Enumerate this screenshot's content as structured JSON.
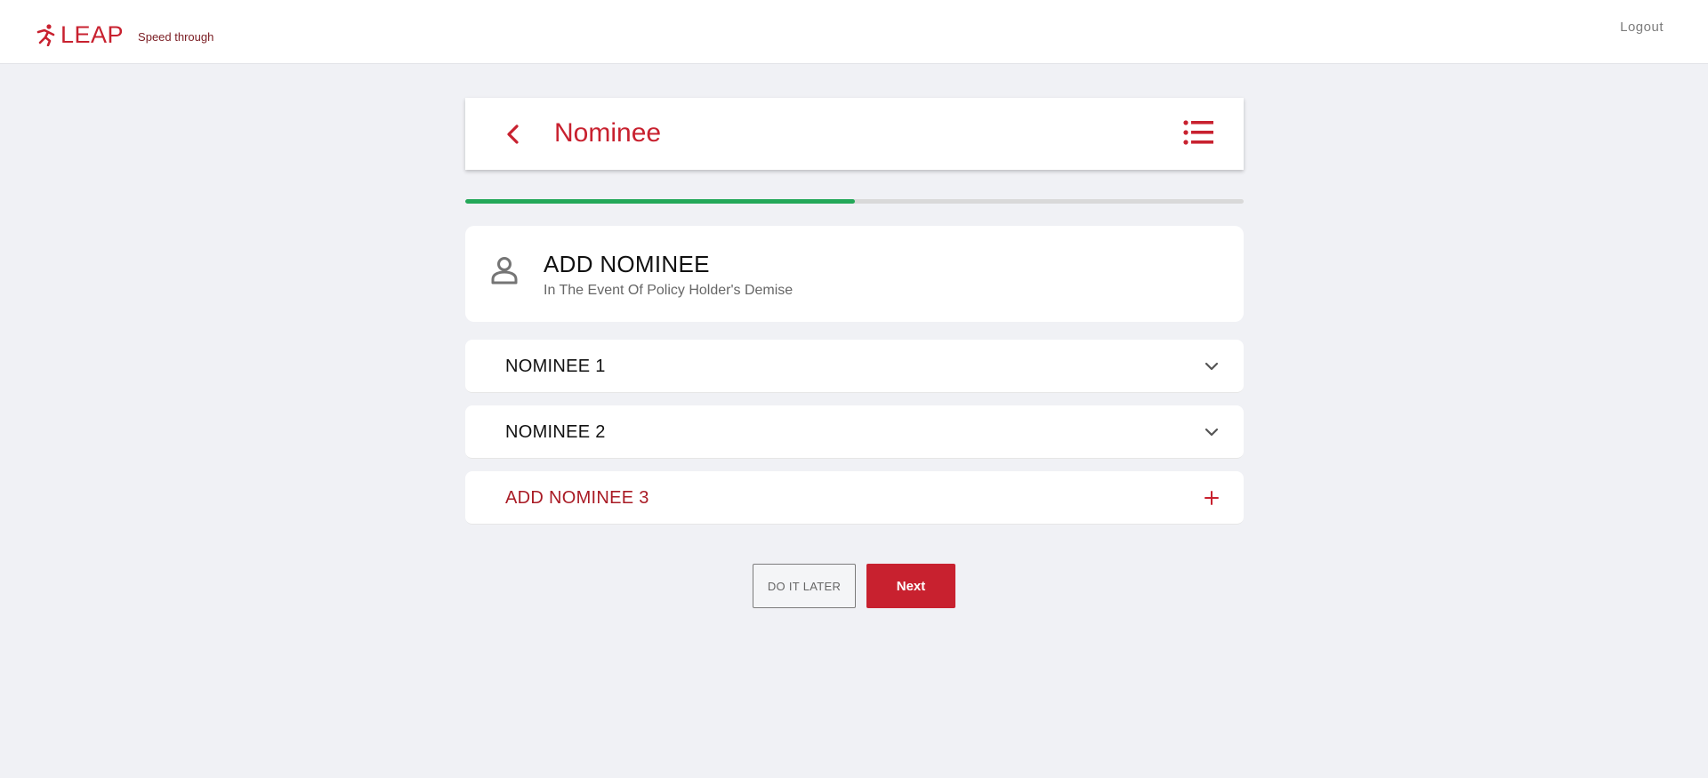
{
  "brand": {
    "name": "LEAP",
    "tagline": "Speed through",
    "logo_icon": "running-person-icon",
    "color": "#c8212f"
  },
  "topbar": {
    "logout_label": "Logout"
  },
  "header": {
    "back_icon": "chevron-left-icon",
    "title": "Nominee",
    "menu_icon": "list-menu-icon"
  },
  "progress": {
    "fraction": 0.5,
    "fill_color": "#24a859"
  },
  "add_card": {
    "icon": "person-icon",
    "title": "ADD NOMINEE",
    "subtitle": "In The Event Of Policy Holder's Demise"
  },
  "nominees": [
    {
      "label": "NOMINEE 1",
      "icon": "chevron-down-icon"
    },
    {
      "label": "NOMINEE 2",
      "icon": "chevron-down-icon"
    },
    {
      "label": "ADD NOMINEE 3",
      "icon": "plus-icon"
    }
  ],
  "actions": {
    "later_label": "DO IT LATER",
    "next_label": "Next"
  }
}
